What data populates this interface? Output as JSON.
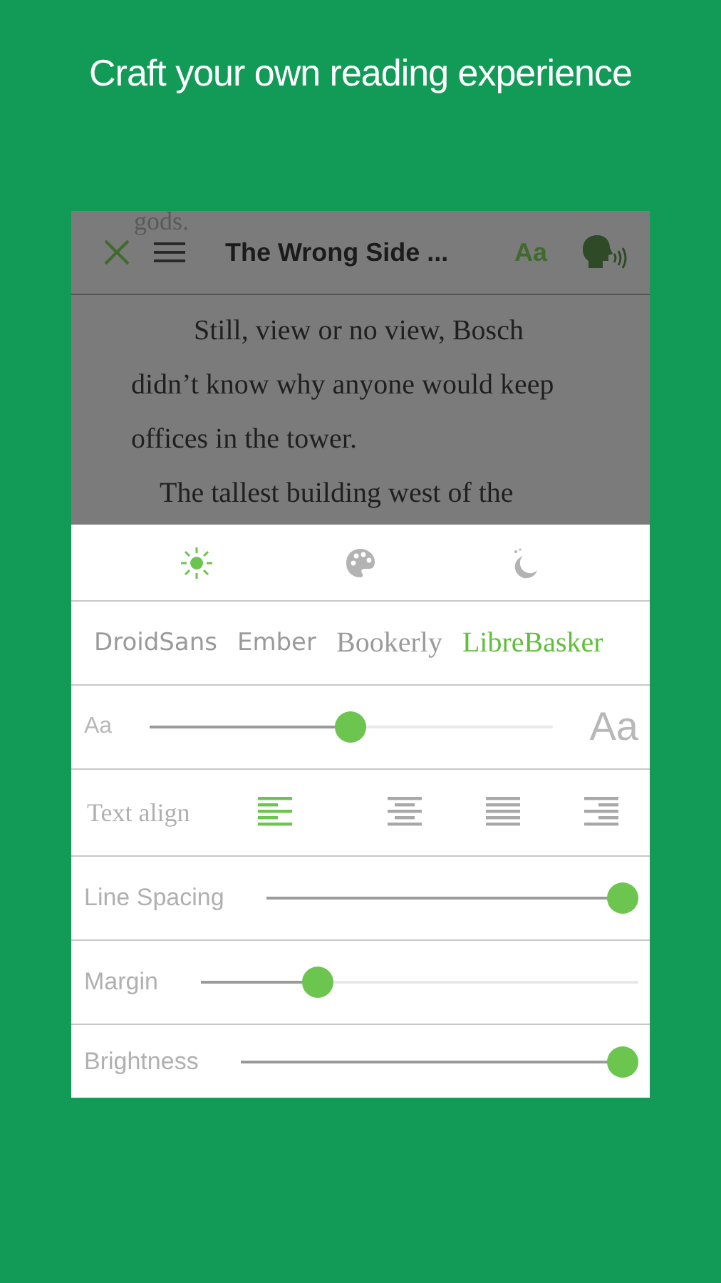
{
  "headline": "Craft your own reading experience",
  "reader": {
    "title": "The Wrong Side ...",
    "font_button": "Aa",
    "prev_line": "gods.",
    "paragraphs": [
      "Still, view or no view, Bosch didn’t know why anyone would keep offices in the tower.",
      "The tallest building west of the"
    ]
  },
  "themes": [
    {
      "kind": "day",
      "selected": true
    },
    {
      "kind": "palette",
      "selected": false
    },
    {
      "kind": "night",
      "selected": false
    }
  ],
  "fonts": [
    {
      "label": "DroidSans",
      "selected": false
    },
    {
      "label": "Ember",
      "selected": false
    },
    {
      "label": "Bookerly",
      "selected": false
    },
    {
      "label": "LibreBasker",
      "selected": true
    }
  ],
  "font_size": {
    "small_label": "Aa",
    "large_label": "Aa",
    "level": 0.5
  },
  "text_align": {
    "label": "Text align",
    "options": [
      {
        "kind": "left",
        "selected": true
      },
      {
        "kind": "center",
        "selected": false
      },
      {
        "kind": "justify",
        "selected": false
      },
      {
        "kind": "right",
        "selected": false
      }
    ]
  },
  "sliders": [
    {
      "label": "Line Spacing",
      "level": 1.0
    },
    {
      "label": "Margin",
      "level": 0.25
    },
    {
      "label": "Brightness",
      "level": 1.0
    }
  ]
}
